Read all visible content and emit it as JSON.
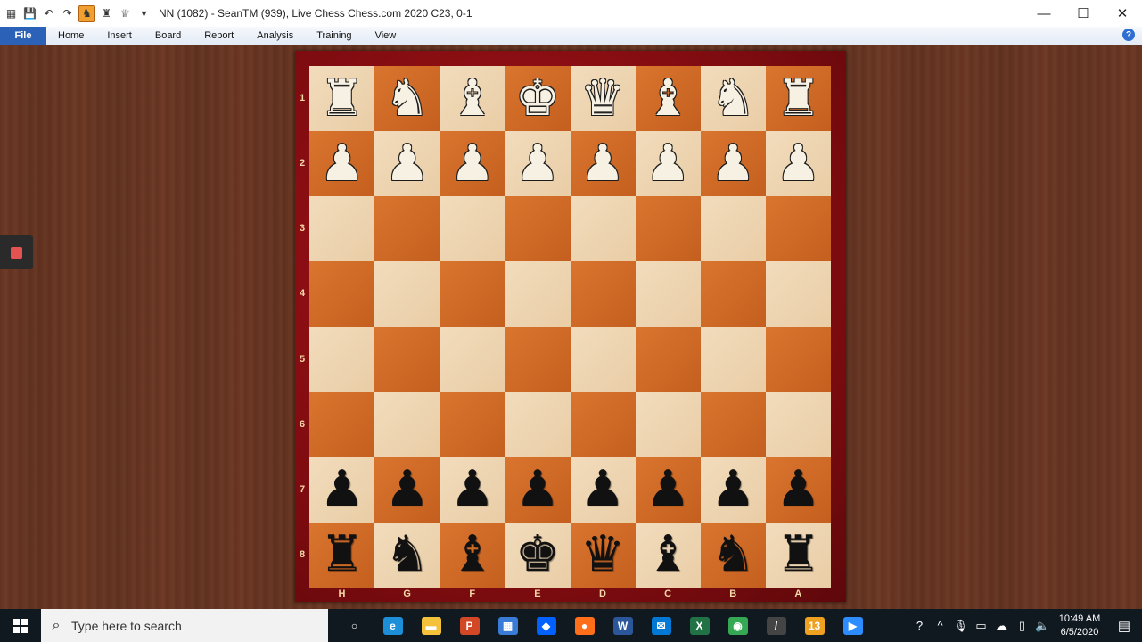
{
  "window": {
    "title": "NN (1082) - SeanTM (939), Live Chess Chess.com 2020  C23, 0-1",
    "controls": [
      "—",
      "☐",
      "✕"
    ]
  },
  "quick_access": [
    "▦",
    "💾",
    "↶",
    "↷",
    "♞",
    "♜",
    "♕",
    "▾"
  ],
  "menu": {
    "file": "File",
    "tabs": [
      "Home",
      "Insert",
      "Board",
      "Report",
      "Analysis",
      "Training",
      "View"
    ],
    "help": "?"
  },
  "board": {
    "ranks": [
      "1",
      "2",
      "3",
      "4",
      "5",
      "6",
      "7",
      "8"
    ],
    "files": [
      "H",
      "G",
      "F",
      "E",
      "D",
      "C",
      "B",
      "A"
    ],
    "rows": [
      [
        "♜",
        "♞",
        "♝",
        "♚",
        "♛",
        "♝",
        "♞",
        "♜"
      ],
      [
        "♟",
        "♟",
        "♟",
        "♟",
        "♟",
        "♟",
        "♟",
        "♟"
      ],
      [
        "",
        "",
        "",
        "",
        "",
        "",
        "",
        ""
      ],
      [
        "",
        "",
        "",
        "",
        "",
        "",
        "",
        ""
      ],
      [
        "",
        "",
        "",
        "",
        "",
        "",
        "",
        ""
      ],
      [
        "",
        "",
        "",
        "",
        "",
        "",
        "",
        ""
      ],
      [
        "♟",
        "♟",
        "♟",
        "♟",
        "♟",
        "♟",
        "♟",
        "♟"
      ],
      [
        "♜",
        "♞",
        "♝",
        "♚",
        "♛",
        "♝",
        "♞",
        "♜"
      ]
    ],
    "colors": [
      "w",
      "w",
      "",
      "",
      "",
      "",
      "b",
      "b"
    ],
    "light_color": "#f2dcbc",
    "dark_color": "#d26a26",
    "frame_color": "#8e0f14"
  },
  "taskbar": {
    "search_placeholder": "Type here to search",
    "apps": [
      {
        "name": "task-view-icon",
        "glyph": "○",
        "color": "transparent"
      },
      {
        "name": "edge-icon",
        "glyph": "e",
        "color": "#1d8fd8"
      },
      {
        "name": "file-explorer-icon",
        "glyph": "▬",
        "color": "#f3c13a"
      },
      {
        "name": "powerpoint-icon",
        "glyph": "P",
        "color": "#d24726"
      },
      {
        "name": "store-icon",
        "glyph": "▦",
        "color": "#3a7bd5"
      },
      {
        "name": "dropbox-icon",
        "glyph": "◆",
        "color": "#0061fe"
      },
      {
        "name": "firefox-icon",
        "glyph": "●",
        "color": "#ff6f1a"
      },
      {
        "name": "word-icon",
        "glyph": "W",
        "color": "#2b579a"
      },
      {
        "name": "mail-icon",
        "glyph": "✉",
        "color": "#0078d4"
      },
      {
        "name": "excel-icon",
        "glyph": "X",
        "color": "#217346"
      },
      {
        "name": "chrome-icon",
        "glyph": "◉",
        "color": "#34a853"
      },
      {
        "name": "chessbase-icon",
        "glyph": "/",
        "color": "#444444"
      },
      {
        "name": "app-13-icon",
        "glyph": "13",
        "color": "#f0a020"
      },
      {
        "name": "zoom-icon",
        "glyph": "▶",
        "color": "#2d8cff"
      }
    ],
    "time": "10:49 AM",
    "date": "6/5/2020"
  }
}
